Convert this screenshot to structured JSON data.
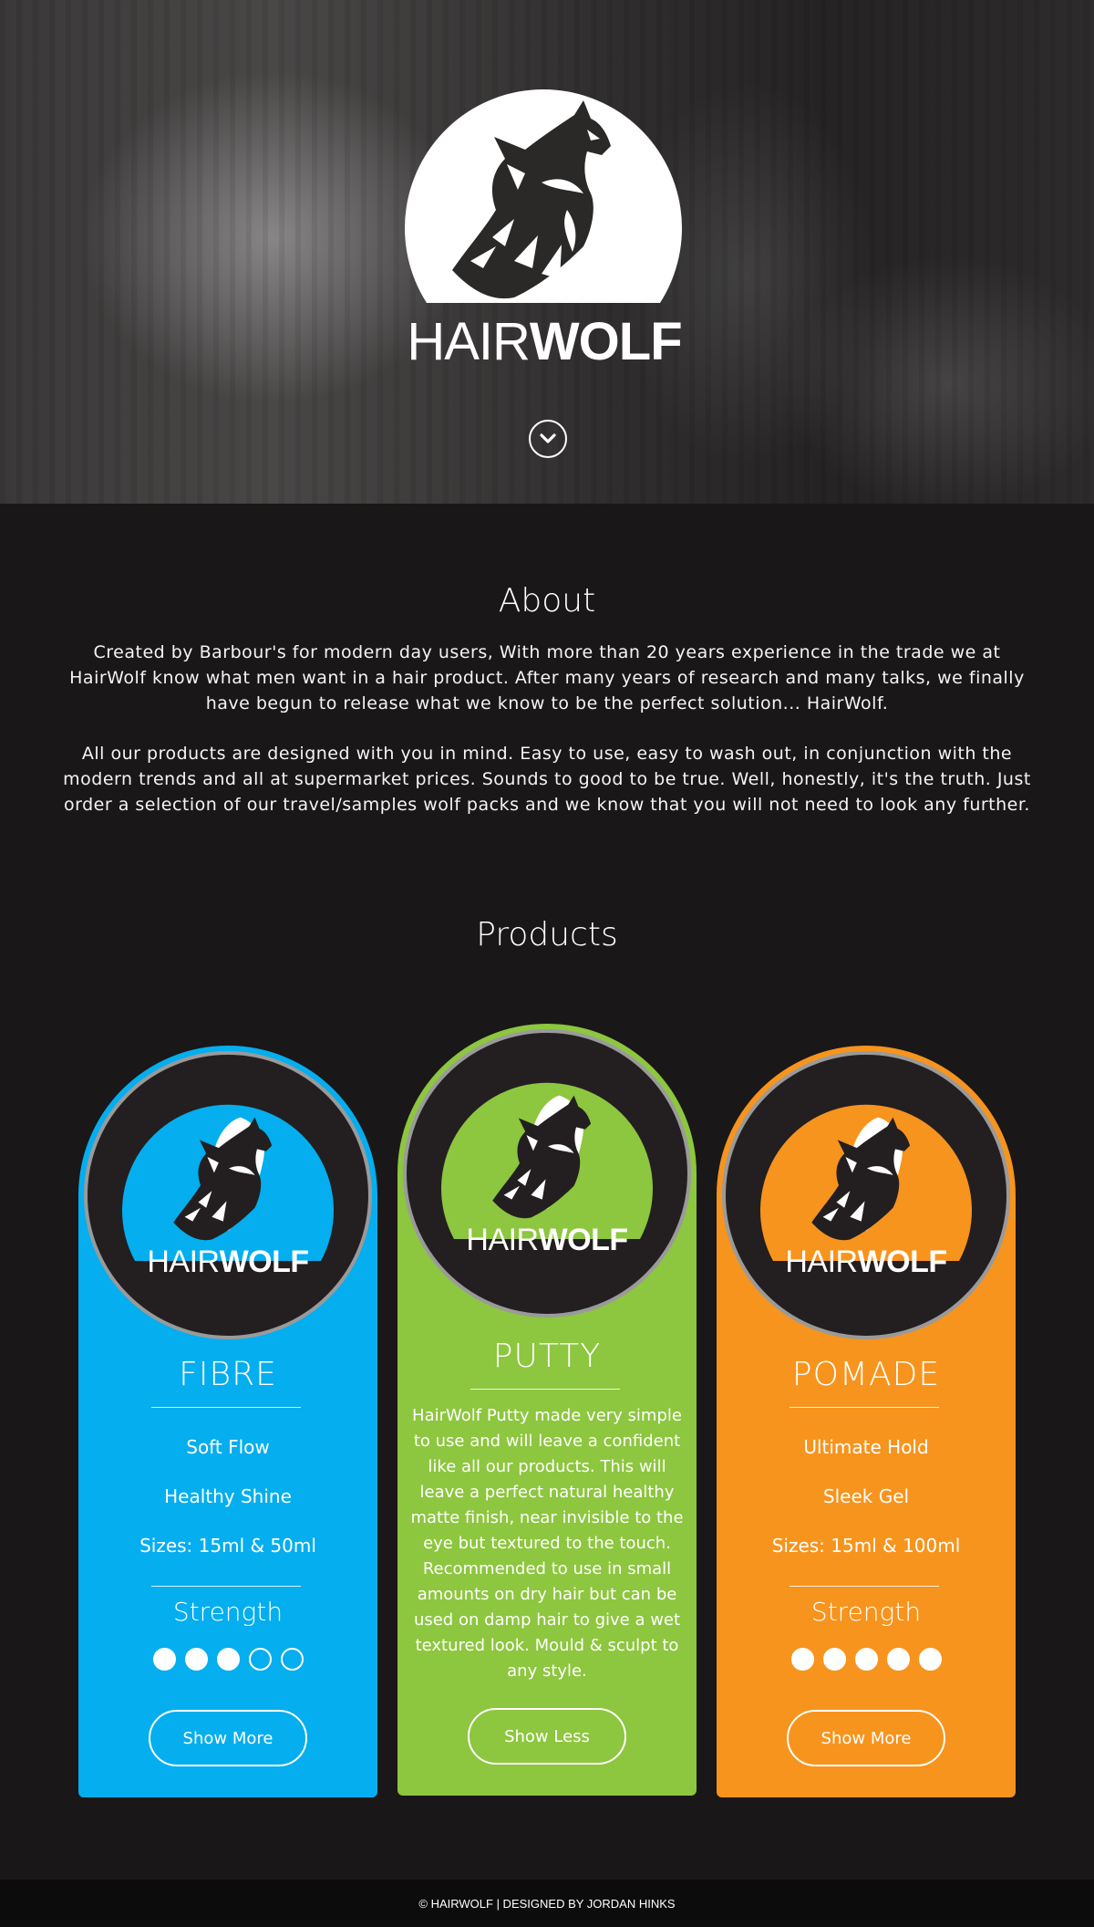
{
  "hero": {
    "brand_light": "HAIR",
    "brand_bold": "WOLF",
    "scroll_icon": "chevron-down-circle-icon"
  },
  "about": {
    "title": "About",
    "paragraph1": "Created by Barbour's for modern day users, With more than 20 years experience in the trade we at HairWolf know what men want in a hair product. After many years of research and many talks, we finally have begun to release what we know to be the perfect solution... HairWolf.",
    "paragraph2": "All our products are designed with you in mind. Easy to use, easy to wash out, in conjunction with the modern trends and all at supermarket prices. Sounds to good to be true. Well, honestly, it's the truth. Just order a selection of our travel/samples wolf packs and we know that you will not need to look any further."
  },
  "products": {
    "title": "Products",
    "items": [
      {
        "name": "FIBRE",
        "color": "#04aeef",
        "brand_light": "HAIR",
        "brand_bold": "WOLF",
        "features": [
          "Soft Flow",
          "Healthy Shine",
          "Sizes: 15ml & 50ml"
        ],
        "strength_label": "Strength",
        "strength": 3,
        "strength_max": 5,
        "button": "Show More"
      },
      {
        "name": "PUTTY",
        "color": "#8dc63f",
        "brand_light": "HAIR",
        "brand_bold": "WOLF",
        "description": "HairWolf Putty made very simple to use and will leave a confident like all our products. This will leave a perfect natural healthy matte finish, near invisible to the eye but textured to the touch. Recommended to use in small amounts on dry hair but can be used on damp hair to give a wet textured look. Mould & sculpt to any style.",
        "button": "Show Less"
      },
      {
        "name": "POMADE",
        "color": "#f7941d",
        "brand_light": "HAIR",
        "brand_bold": "WOLF",
        "features": [
          "Ultimate Hold",
          "Sleek Gel",
          "Sizes: 15ml & 100ml"
        ],
        "strength_label": "Strength",
        "strength": 5,
        "strength_max": 5,
        "button": "Show More"
      }
    ]
  },
  "footer": {
    "text": "© HAIRWOLF | DESIGNED BY JORDAN HINKS"
  }
}
